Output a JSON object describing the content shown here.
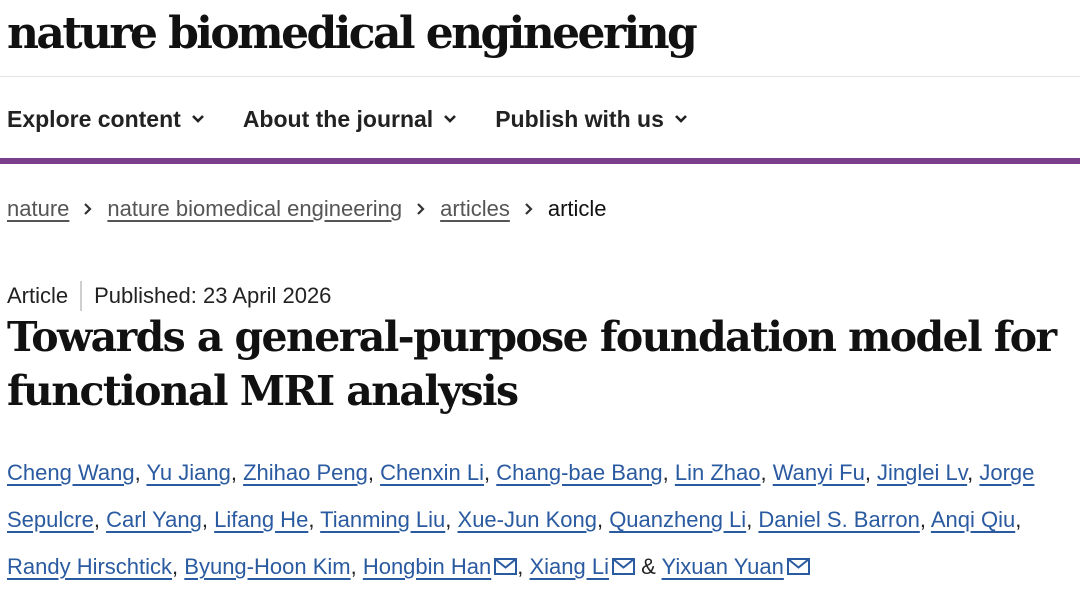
{
  "masthead": {
    "title": "nature biomedical engineering"
  },
  "nav": {
    "items": [
      {
        "label": "Explore content"
      },
      {
        "label": "About the journal"
      },
      {
        "label": "Publish with us"
      }
    ]
  },
  "colors": {
    "accent": "#7c3f8c",
    "link": "#2a5aa0",
    "breadcrumb_link": "#555555"
  },
  "breadcrumb": {
    "items": [
      "nature",
      "nature biomedical engineering",
      "articles"
    ],
    "current": "article"
  },
  "article": {
    "type": "Article",
    "published": "Published: 23 April 2026",
    "title": "Towards a general-purpose foundation model for functional MRI analysis"
  },
  "authors": [
    {
      "name": "Cheng Wang"
    },
    {
      "name": "Yu Jiang"
    },
    {
      "name": "Zhihao Peng"
    },
    {
      "name": "Chenxin Li"
    },
    {
      "name": "Chang-bae Bang"
    },
    {
      "name": "Lin Zhao"
    },
    {
      "name": "Wanyi Fu"
    },
    {
      "name": "Jinglei Lv"
    },
    {
      "name": "Jorge Sepulcre"
    },
    {
      "name": "Carl Yang"
    },
    {
      "name": "Lifang He"
    },
    {
      "name": "Tianming Liu"
    },
    {
      "name": "Xue-Jun Kong"
    },
    {
      "name": "Quanzheng Li"
    },
    {
      "name": "Daniel S. Barron"
    },
    {
      "name": "Anqi Qiu"
    },
    {
      "name": "Randy Hirschtick"
    },
    {
      "name": "Byung-Hoon Kim"
    },
    {
      "name": "Hongbin Han",
      "mail": true
    },
    {
      "name": "Xiang Li",
      "mail": true
    },
    {
      "name": "Yixuan Yuan",
      "mail": true
    }
  ],
  "icons": {
    "nav_dropdown": "chevron-down-icon",
    "breadcrumb_separator": "chevron-right-icon",
    "author_contact": "envelope-icon"
  }
}
